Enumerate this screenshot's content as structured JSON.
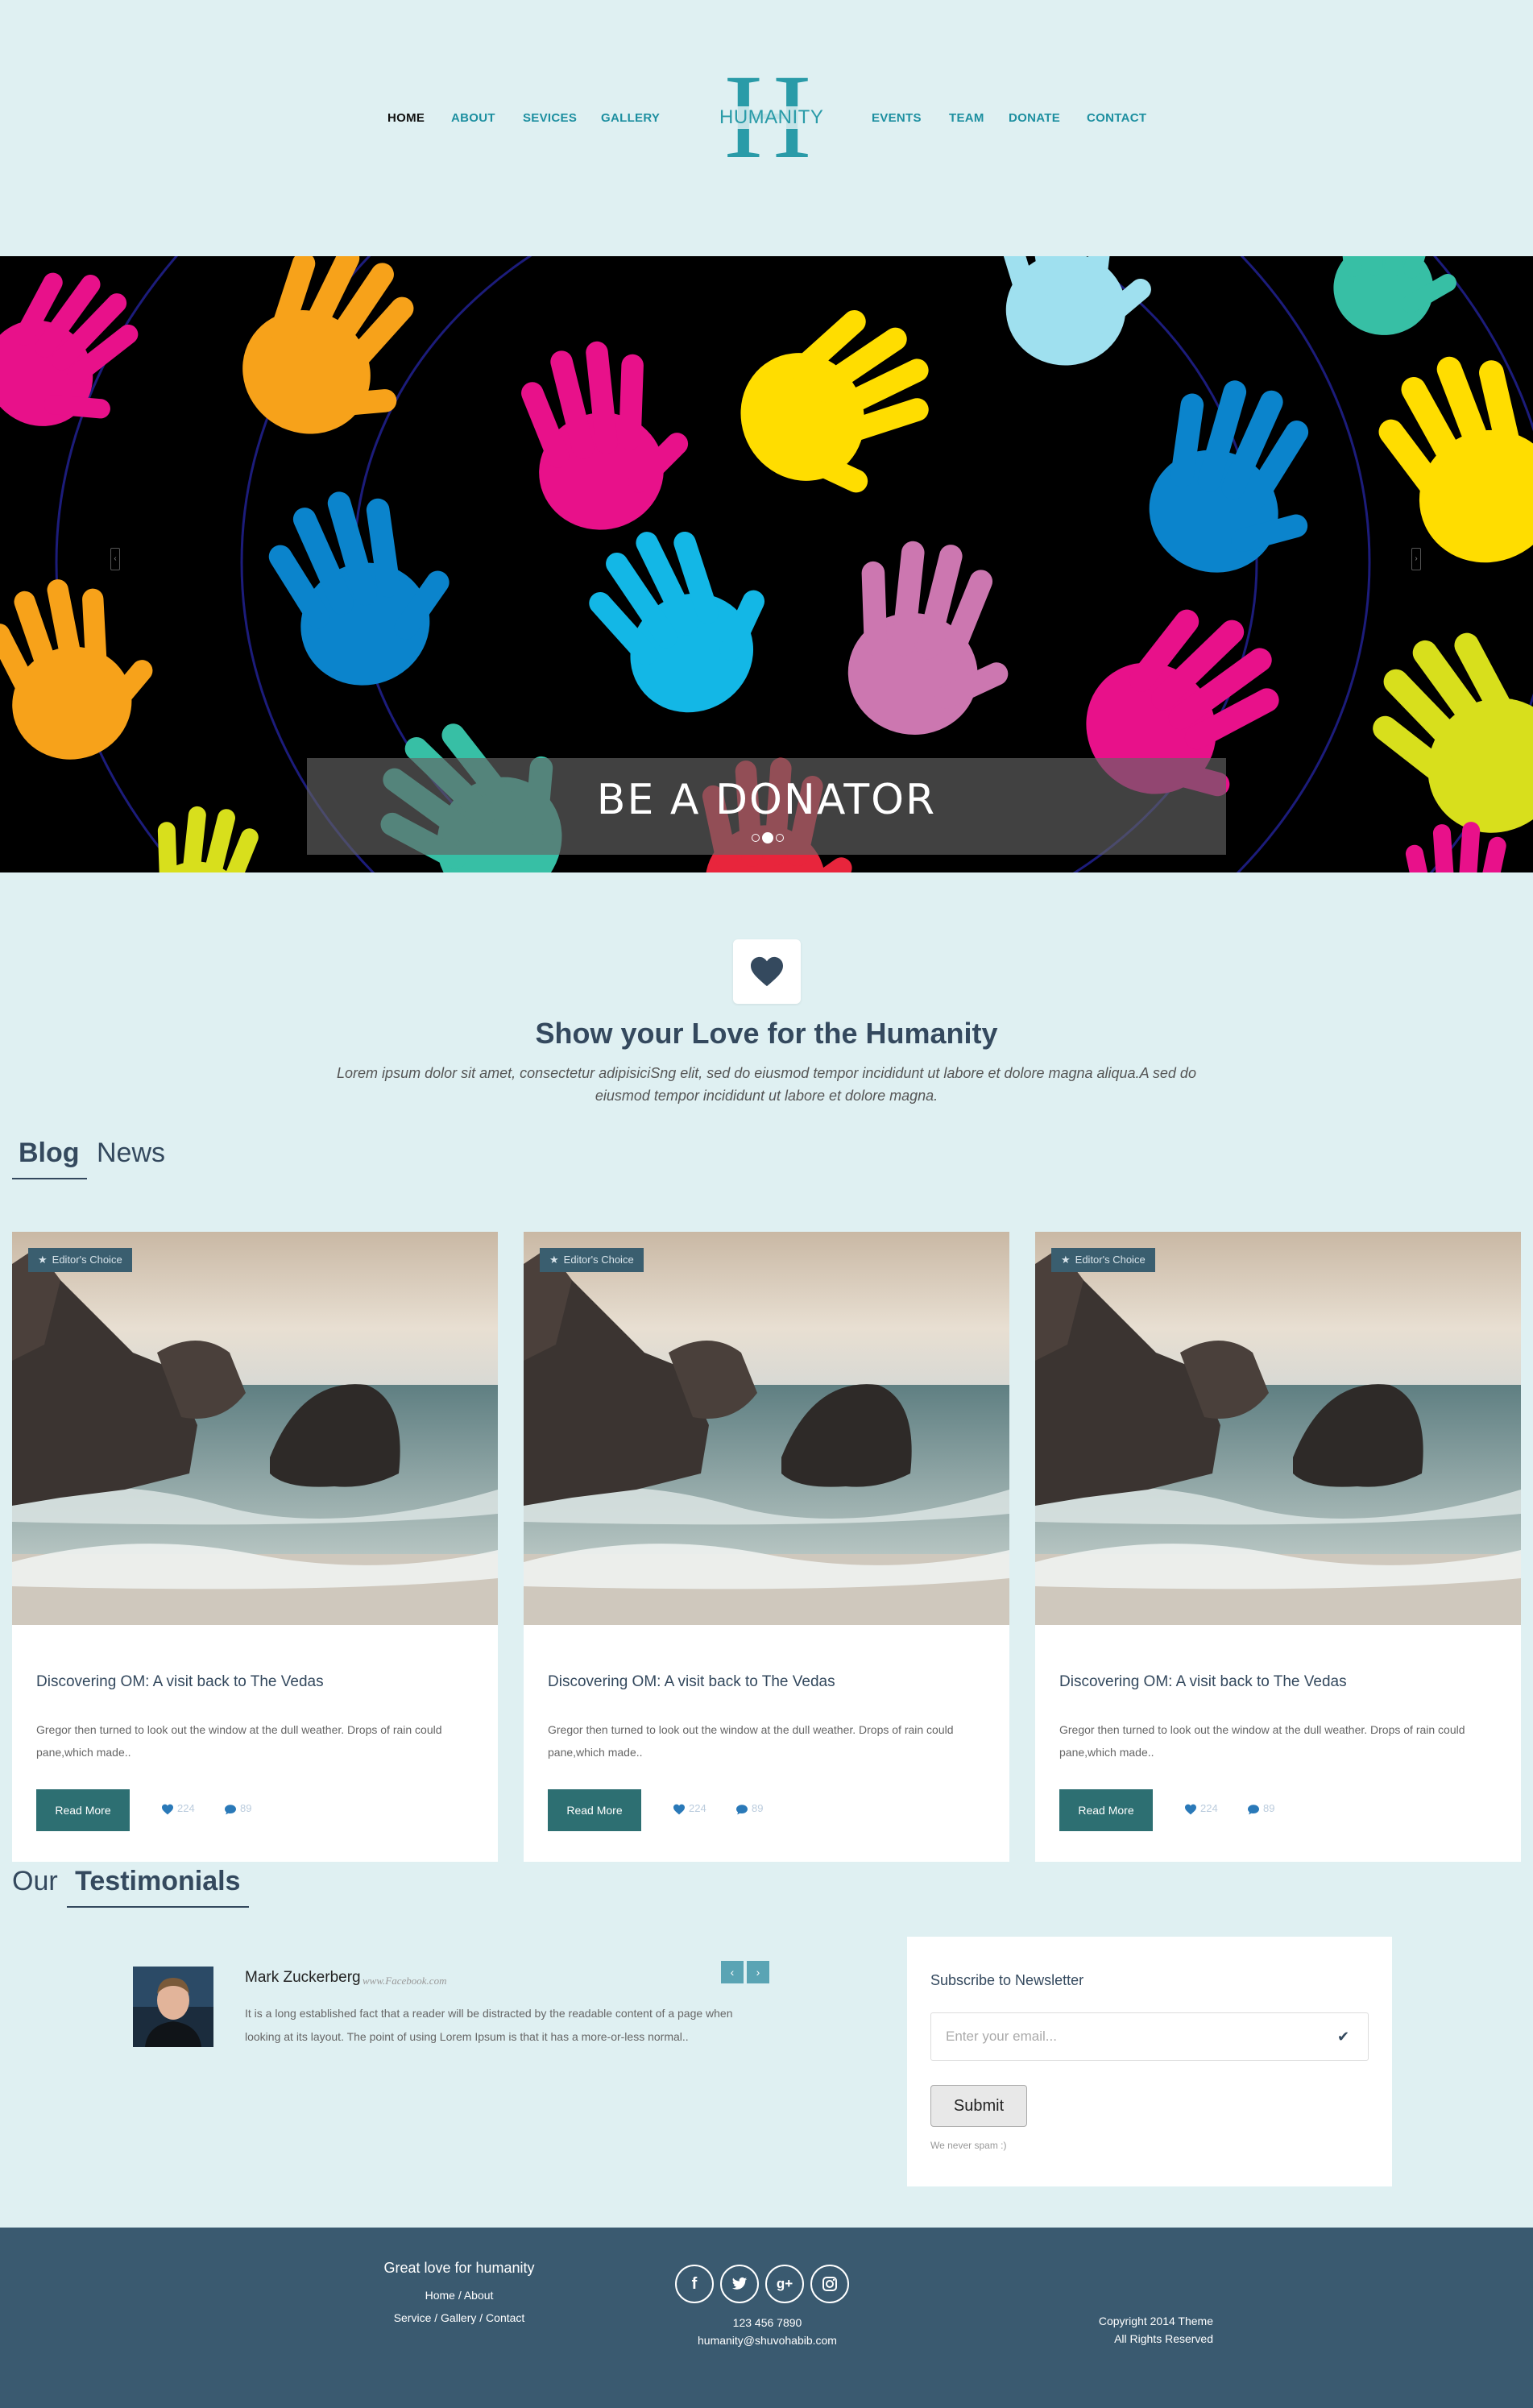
{
  "nav": {
    "left": [
      "HOME",
      "ABOUT",
      "SEVICES",
      "GALLERY"
    ],
    "right": [
      "EVENTS",
      "TEAM",
      "DONATE",
      "CONTACT"
    ],
    "active": "HOME",
    "logo_letter": "H",
    "logo_word": "HUMANITY"
  },
  "hero": {
    "caption": "BE A DONATOR",
    "slide_count": 3,
    "active_slide": 2
  },
  "love": {
    "title": "Show your Love for the Humanity",
    "text": "Lorem ipsum dolor sit amet, consectetur adipisiciSng elit, sed do eiusmod tempor incididunt ut labore et dolore magna aliqua.A sed do eiusmod tempor incididunt ut labore et dolore magna."
  },
  "blog": {
    "heading_bold": "Blog",
    "heading_rest": "News",
    "cards": [
      {
        "badge": "Editor's Choice",
        "title": "Discovering OM: A visit back to The Vedas",
        "text": "Gregor then turned to look out the window at the dull weather. Drops of rain could pane,which made..",
        "button": "Read More",
        "likes": "224",
        "comments": "89"
      },
      {
        "badge": "Editor's Choice",
        "title": "Discovering OM: A visit back to The Vedas",
        "text": "Gregor then turned to look out the window at the dull weather. Drops of rain could pane,which made..",
        "button": "Read More",
        "likes": "224",
        "comments": "89"
      },
      {
        "badge": "Editor's Choice",
        "title": "Discovering OM: A visit back to The Vedas",
        "text": "Gregor then turned to look out the window at the dull weather. Drops of rain could pane,which made..",
        "button": "Read More",
        "likes": "224",
        "comments": "89"
      }
    ]
  },
  "testimonials": {
    "heading_rest": "Our",
    "heading_bold": "Testimonials",
    "name": "Mark Zuckerberg",
    "site": "www.Facebook.com",
    "text": "It is a long established fact that a reader will be distracted by the readable content of a page when looking at its layout. The point of using Lorem Ipsum is that it has a more-or-less normal..",
    "prev": "‹",
    "next": "›"
  },
  "newsletter": {
    "title": "Subscribe to Newsletter",
    "placeholder": "Enter your email...",
    "button": "Submit",
    "note": "We never spam :)"
  },
  "footer": {
    "title": "Great love for humanity",
    "links_line1": "Home / About",
    "links_line2": "Service / Gallery / Contact",
    "social": [
      "facebook-icon",
      "twitter-icon",
      "google-plus-icon",
      "instagram-icon"
    ],
    "phone": "123 456 7890",
    "email": "humanity@shuvohabib.com",
    "copyright_line1": "Copyright 2014 Theme",
    "copyright_line2": "All Rights Reserved"
  },
  "colors": {
    "background": "#dff0f2",
    "nav_link": "#1d8fa0",
    "heading": "#34495e",
    "button": "#2d6f72",
    "footer": "#3a5a70"
  }
}
